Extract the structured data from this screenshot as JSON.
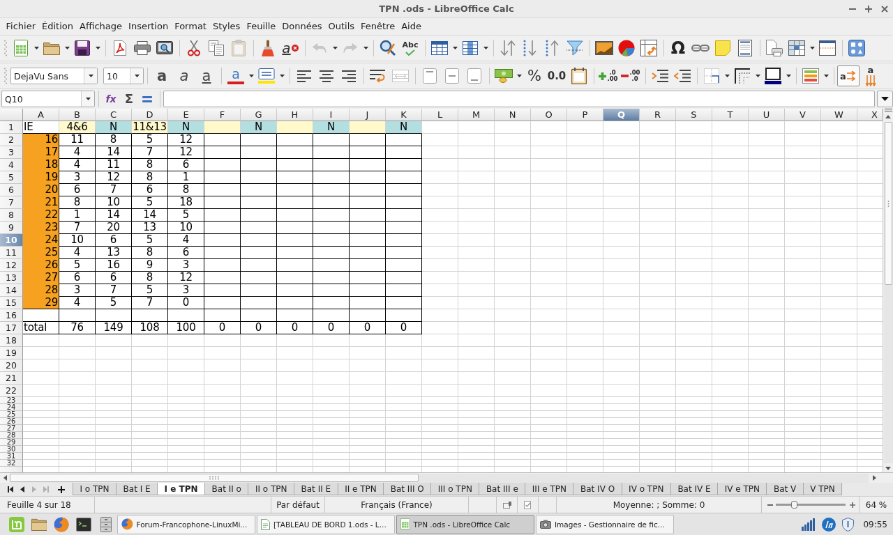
{
  "window": {
    "title": "TPN .ods - LibreOffice Calc"
  },
  "menu": [
    "Fichier",
    "Édition",
    "Affichage",
    "Insertion",
    "Format",
    "Styles",
    "Feuille",
    "Données",
    "Outils",
    "Fenêtre",
    "Aide"
  ],
  "standard_toolbar": {
    "paste": {
      "disabled": true
    },
    "clear_formatting": "a",
    "undo": {
      "disabled": true
    },
    "redo": {
      "disabled": true
    },
    "spelling": "Abc",
    "special_character": "Ω"
  },
  "formatting_toolbar": {
    "font_name": "DejaVu Sans",
    "font_size": "10",
    "bold": "a",
    "italic": "a",
    "underline": "a",
    "font_color": "a",
    "merge_cells": {
      "disabled": true
    },
    "percent": "%",
    "number_format": "0.0",
    "add_decimal": [
      ".0",
      ".00"
    ],
    "delete_decimal": [
      ".00",
      ".0"
    ],
    "text_direction": [
      {
        "kind": "horizontal",
        "glyph": "a",
        "selected": true
      },
      {
        "kind": "vertical",
        "glyph": "a",
        "selected": false
      }
    ]
  },
  "formula_bar": {
    "name_box": "Q10",
    "function_wizard": "fx",
    "sum": "Σ"
  },
  "sheet": {
    "columns": [
      {
        "label": "A",
        "selected": false
      },
      {
        "label": "B",
        "selected": false
      },
      {
        "label": "C",
        "selected": false
      },
      {
        "label": "D",
        "selected": false
      },
      {
        "label": "E",
        "selected": false
      },
      {
        "label": "F",
        "selected": false
      },
      {
        "label": "G",
        "selected": false
      },
      {
        "label": "H",
        "selected": false
      },
      {
        "label": "I",
        "selected": false
      },
      {
        "label": "J",
        "selected": false
      },
      {
        "label": "K",
        "selected": false
      },
      {
        "label": "L",
        "selected": false
      },
      {
        "label": "M",
        "selected": false
      },
      {
        "label": "N",
        "selected": false
      },
      {
        "label": "O",
        "selected": false
      },
      {
        "label": "P",
        "selected": false
      },
      {
        "label": "Q",
        "selected": true
      },
      {
        "label": "R",
        "selected": false
      },
      {
        "label": "S",
        "selected": false
      },
      {
        "label": "T",
        "selected": false
      },
      {
        "label": "U",
        "selected": false
      },
      {
        "label": "V",
        "selected": false
      },
      {
        "label": "W",
        "selected": false
      },
      {
        "label": "X",
        "selected": false
      }
    ],
    "rows": [
      {
        "label": "1",
        "selected": false,
        "bordered": false,
        "cells": [
          {
            "kind": "label",
            "text": "IE"
          },
          {
            "kind": "value",
            "text": "4&6",
            "color": "#fff9cc"
          },
          {
            "kind": "value",
            "text": "N",
            "color": "#b4dfe1"
          },
          {
            "kind": "value",
            "text": "11&13",
            "color": "#fff9cc"
          },
          {
            "kind": "value",
            "text": "N",
            "color": "#b4dfe1"
          },
          {
            "kind": "blank",
            "color": "#fff9cc"
          },
          {
            "kind": "value",
            "text": "N",
            "color": "#b4dfe1"
          },
          {
            "kind": "blank",
            "color": "#fff9cc"
          },
          {
            "kind": "value",
            "text": "N",
            "color": "#b4dfe1"
          },
          {
            "kind": "blank",
            "color": "#fff9cc"
          },
          {
            "kind": "value",
            "text": "N",
            "color": "#b4dfe1"
          }
        ]
      },
      {
        "label": "2",
        "selected": false,
        "bordered": true,
        "cells": [
          {
            "kind": "index",
            "text": "16",
            "color": "#f6a11f"
          },
          {
            "kind": "value",
            "text": "11"
          },
          {
            "kind": "value",
            "text": "8"
          },
          {
            "kind": "value",
            "text": "5"
          },
          {
            "kind": "value",
            "text": "12"
          }
        ]
      },
      {
        "label": "3",
        "selected": false,
        "bordered": true,
        "cells": [
          {
            "kind": "index",
            "text": "17",
            "color": "#f6a11f"
          },
          {
            "kind": "value",
            "text": "4"
          },
          {
            "kind": "value",
            "text": "14"
          },
          {
            "kind": "value",
            "text": "7"
          },
          {
            "kind": "value",
            "text": "12"
          }
        ]
      },
      {
        "label": "4",
        "selected": false,
        "bordered": true,
        "cells": [
          {
            "kind": "index",
            "text": "18",
            "color": "#f6a11f"
          },
          {
            "kind": "value",
            "text": "4"
          },
          {
            "kind": "value",
            "text": "11"
          },
          {
            "kind": "value",
            "text": "8"
          },
          {
            "kind": "value",
            "text": "6"
          }
        ]
      },
      {
        "label": "5",
        "selected": false,
        "bordered": true,
        "cells": [
          {
            "kind": "index",
            "text": "19",
            "color": "#f6a11f"
          },
          {
            "kind": "value",
            "text": "3"
          },
          {
            "kind": "value",
            "text": "12"
          },
          {
            "kind": "value",
            "text": "8"
          },
          {
            "kind": "value",
            "text": "1"
          }
        ]
      },
      {
        "label": "6",
        "selected": false,
        "bordered": true,
        "cells": [
          {
            "kind": "index",
            "text": "20",
            "color": "#f6a11f"
          },
          {
            "kind": "value",
            "text": "6"
          },
          {
            "kind": "value",
            "text": "7"
          },
          {
            "kind": "value",
            "text": "6"
          },
          {
            "kind": "value",
            "text": "8"
          }
        ]
      },
      {
        "label": "7",
        "selected": false,
        "bordered": true,
        "cells": [
          {
            "kind": "index",
            "text": "21",
            "color": "#f6a11f"
          },
          {
            "kind": "value",
            "text": "8"
          },
          {
            "kind": "value",
            "text": "10"
          },
          {
            "kind": "value",
            "text": "5"
          },
          {
            "kind": "value",
            "text": "18"
          }
        ]
      },
      {
        "label": "8",
        "selected": false,
        "bordered": true,
        "cells": [
          {
            "kind": "index",
            "text": "22",
            "color": "#f6a11f"
          },
          {
            "kind": "value",
            "text": "1"
          },
          {
            "kind": "value",
            "text": "14"
          },
          {
            "kind": "value",
            "text": "14"
          },
          {
            "kind": "value",
            "text": "5"
          }
        ]
      },
      {
        "label": "9",
        "selected": false,
        "bordered": true,
        "cells": [
          {
            "kind": "index",
            "text": "23",
            "color": "#f6a11f"
          },
          {
            "kind": "value",
            "text": "7"
          },
          {
            "kind": "value",
            "text": "20"
          },
          {
            "kind": "value",
            "text": "13"
          },
          {
            "kind": "value",
            "text": "10"
          }
        ]
      },
      {
        "label": "10",
        "selected": true,
        "bordered": true,
        "cells": [
          {
            "kind": "index",
            "text": "24",
            "color": "#f6a11f"
          },
          {
            "kind": "value",
            "text": "10"
          },
          {
            "kind": "value",
            "text": "6"
          },
          {
            "kind": "value",
            "text": "5"
          },
          {
            "kind": "value",
            "text": "4"
          }
        ]
      },
      {
        "label": "11",
        "selected": false,
        "bordered": true,
        "cells": [
          {
            "kind": "index",
            "text": "25",
            "color": "#f6a11f"
          },
          {
            "kind": "value",
            "text": "4"
          },
          {
            "kind": "value",
            "text": "13"
          },
          {
            "kind": "value",
            "text": "8"
          },
          {
            "kind": "value",
            "text": "6"
          }
        ]
      },
      {
        "label": "12",
        "selected": false,
        "bordered": true,
        "cells": [
          {
            "kind": "index",
            "text": "26",
            "color": "#f6a11f"
          },
          {
            "kind": "value",
            "text": "5"
          },
          {
            "kind": "value",
            "text": "16"
          },
          {
            "kind": "value",
            "text": "9"
          },
          {
            "kind": "value",
            "text": "3"
          }
        ]
      },
      {
        "label": "13",
        "selected": false,
        "bordered": true,
        "cells": [
          {
            "kind": "index",
            "text": "27",
            "color": "#f6a11f"
          },
          {
            "kind": "value",
            "text": "6"
          },
          {
            "kind": "value",
            "text": "6"
          },
          {
            "kind": "value",
            "text": "8"
          },
          {
            "kind": "value",
            "text": "12"
          }
        ]
      },
      {
        "label": "14",
        "selected": false,
        "bordered": true,
        "cells": [
          {
            "kind": "index",
            "text": "28",
            "color": "#f6a11f"
          },
          {
            "kind": "value",
            "text": "3"
          },
          {
            "kind": "value",
            "text": "7"
          },
          {
            "kind": "value",
            "text": "5"
          },
          {
            "kind": "value",
            "text": "3"
          }
        ]
      },
      {
        "label": "15",
        "selected": false,
        "bordered": true,
        "cells": [
          {
            "kind": "index",
            "text": "29",
            "color": "#f6a11f"
          },
          {
            "kind": "value",
            "text": "4"
          },
          {
            "kind": "value",
            "text": "5"
          },
          {
            "kind": "value",
            "text": "7"
          },
          {
            "kind": "value",
            "text": "0"
          }
        ]
      },
      {
        "label": "16",
        "selected": false,
        "bordered": true
      },
      {
        "label": "17",
        "selected": false,
        "bordered": true,
        "cells": [
          {
            "kind": "label",
            "text": "total"
          },
          {
            "kind": "value",
            "text": "76"
          },
          {
            "kind": "value",
            "text": "149"
          },
          {
            "kind": "value",
            "text": "108"
          },
          {
            "kind": "value",
            "text": "100"
          },
          {
            "kind": "value",
            "text": "0"
          },
          {
            "kind": "value",
            "text": "0"
          },
          {
            "kind": "value",
            "text": "0"
          },
          {
            "kind": "value",
            "text": "0"
          },
          {
            "kind": "value",
            "text": "0"
          },
          {
            "kind": "value",
            "text": "0"
          }
        ]
      },
      {
        "label": "18",
        "selected": false,
        "bordered": false
      },
      {
        "label": "19",
        "selected": false,
        "bordered": false
      },
      {
        "label": "20",
        "selected": false,
        "bordered": false
      },
      {
        "label": "21",
        "selected": false,
        "bordered": false
      },
      {
        "label": "22",
        "selected": false,
        "bordered": false
      },
      {
        "label": "23",
        "selected": false,
        "bordered": false
      },
      {
        "label": "24",
        "selected": false,
        "bordered": false
      },
      {
        "label": "25",
        "selected": false,
        "bordered": false
      },
      {
        "label": "26",
        "selected": false,
        "bordered": false
      },
      {
        "label": "27",
        "selected": false,
        "bordered": false
      },
      {
        "label": "28",
        "selected": false,
        "bordered": false
      },
      {
        "label": "29",
        "selected": false,
        "bordered": false
      },
      {
        "label": "30",
        "selected": false,
        "bordered": false
      },
      {
        "label": "31",
        "selected": false,
        "bordered": false
      },
      {
        "label": "32",
        "selected": false,
        "bordered": false
      }
    ]
  },
  "sheet_navigation": [
    {
      "disabled": false
    },
    {
      "disabled": false
    },
    {
      "disabled": true
    },
    {
      "disabled": true
    }
  ],
  "sheet_tabs": [
    {
      "label": "I o TPN",
      "selected": false
    },
    {
      "label": "Bat I E",
      "selected": false
    },
    {
      "label": "I e TPN",
      "selected": true
    },
    {
      "label": "Bat II o",
      "selected": false
    },
    {
      "label": "II o TPN",
      "selected": false
    },
    {
      "label": "Bat II E",
      "selected": false
    },
    {
      "label": "II e TPN",
      "selected": false
    },
    {
      "label": "Bat III O",
      "selected": false
    },
    {
      "label": "III o TPN",
      "selected": false
    },
    {
      "label": "Bat III e",
      "selected": false
    },
    {
      "label": "III e TPN",
      "selected": false
    },
    {
      "label": "Bat IV O",
      "selected": false
    },
    {
      "label": "IV o TPN",
      "selected": false
    },
    {
      "label": "Bat IV E",
      "selected": false
    },
    {
      "label": "IV e TPN",
      "selected": false
    },
    {
      "label": "Bat V",
      "selected": false
    },
    {
      "label": "V TPN",
      "selected": false
    }
  ],
  "status_bar": {
    "sheet": "Feuille 4 sur 18",
    "page_style": "Par défaut",
    "language": "Français (France)",
    "summary": "Moyenne: ; Somme: 0",
    "zoom": {
      "level": 0.26,
      "reading": "64 %"
    }
  },
  "taskbar": {
    "tasks": [
      {
        "kind": "browser",
        "label": "Forum-Francophone-LinuxMi...",
        "selected": false
      },
      {
        "kind": "document",
        "label": "[TABLEAU DE BORD 1.ods - L...",
        "selected": false
      },
      {
        "kind": "spreadsheet",
        "label": "TPN .ods - LibreOffice Calc",
        "selected": true
      },
      {
        "kind": "images",
        "label": "Images - Gestionnaire de fic...",
        "selected": false
      }
    ],
    "clock": "09:55"
  }
}
